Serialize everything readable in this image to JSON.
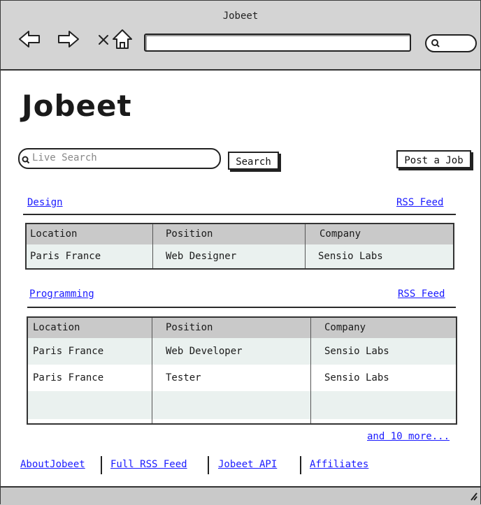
{
  "window": {
    "title": "Jobeet"
  },
  "page": {
    "title": "Jobeet",
    "search": {
      "placeholder": "Live Search",
      "value": "",
      "button": "Search"
    },
    "post_job_label": "Post a Job"
  },
  "categories": [
    {
      "name": "Design",
      "rss_label": "RSS Feed",
      "columns": [
        "Location",
        "Position",
        "Company"
      ],
      "rows": [
        [
          "Paris France",
          "Web Designer",
          "Sensio Labs"
        ]
      ]
    },
    {
      "name": "Programming",
      "rss_label": "RSS Feed",
      "columns": [
        "Location",
        "Position",
        "Company"
      ],
      "rows": [
        [
          "Paris France",
          "Web Developer",
          "Sensio Labs"
        ],
        [
          "Paris France",
          "Tester",
          "Sensio Labs"
        ]
      ],
      "more_label": "and 10 more..."
    }
  ],
  "footer": {
    "links": [
      "AboutJobeet",
      "Full RSS Feed",
      "Jobeet API",
      "Affiliates"
    ]
  },
  "icons": {
    "back": "back-arrow-icon",
    "forward": "forward-arrow-icon",
    "stop": "close-icon",
    "home": "home-icon",
    "search": "search-icon"
  },
  "colors": {
    "link": "#1a1aff",
    "header_row": "#c9c9c9",
    "shaded_row": "#eaf1ef",
    "chrome": "#d4d4d4"
  }
}
